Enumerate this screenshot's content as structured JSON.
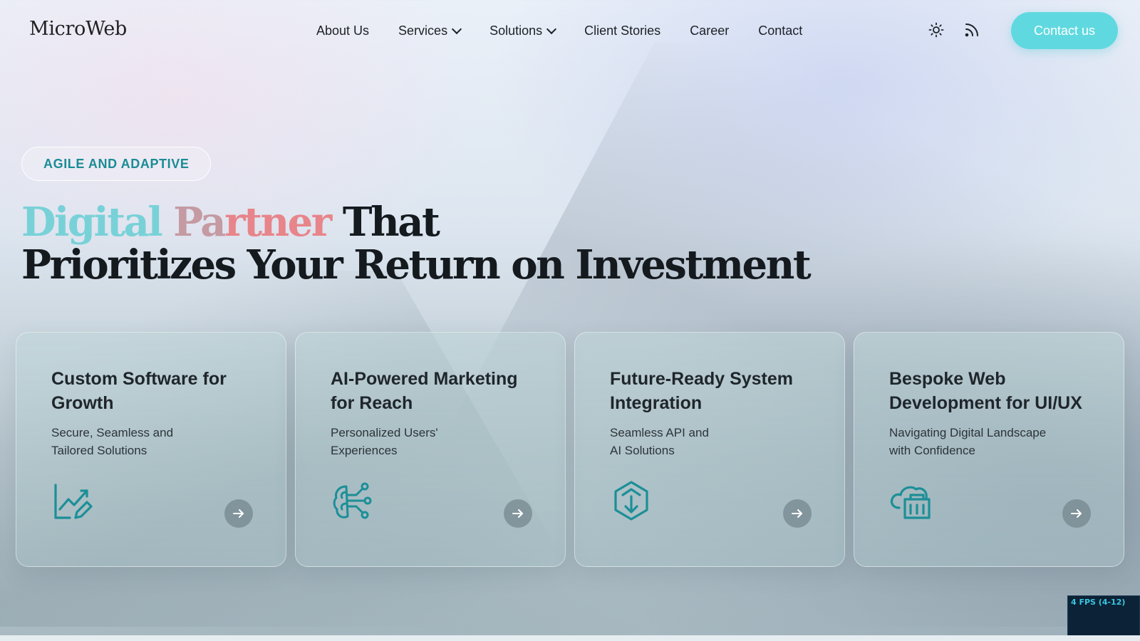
{
  "brand": {
    "logo_text": "MicroWeb"
  },
  "nav": {
    "items": [
      {
        "label": "About Us",
        "dropdown": false
      },
      {
        "label": "Services",
        "dropdown": true
      },
      {
        "label": "Solutions",
        "dropdown": true
      },
      {
        "label": "Client Stories",
        "dropdown": false
      },
      {
        "label": "Career",
        "dropdown": false
      },
      {
        "label": "Contact",
        "dropdown": false
      }
    ],
    "icons": [
      "sun-icon",
      "rss-icon"
    ],
    "cta_label": "Contact us"
  },
  "hero": {
    "badge": "AGILE AND ADAPTIVE",
    "title_word1": "Digital",
    "title_word2_a": "Pa",
    "title_word2_b": "rtner",
    "title_rest": "That",
    "title_line2": "Prioritizes Your Return on Investment"
  },
  "cards": [
    {
      "title": "Custom Software for Growth",
      "subtitle_line1": "Secure, Seamless and",
      "subtitle_line2": "Tailored Solutions",
      "icon": "growth-chart-icon"
    },
    {
      "title": "AI-Powered Marketing for Reach",
      "subtitle_line1": "Personalized Users'",
      "subtitle_line2": "Experiences",
      "icon": "neural-network-icon"
    },
    {
      "title": "Future-Ready System Integration",
      "subtitle_line1": "Seamless API and",
      "subtitle_line2": "AI Solutions",
      "icon": "integration-icon"
    },
    {
      "title": "Bespoke Web Development for UI/UX",
      "subtitle_line1": "Navigating Digital Landscape",
      "subtitle_line2": "with Confidence",
      "icon": "cloud-building-icon"
    }
  ],
  "overlay": {
    "fps_label": "4 FPS (4-12)"
  },
  "colors": {
    "accent": "#5fd9df",
    "badge_text": "#1a8c96",
    "icon_teal": "#1c8f97"
  }
}
